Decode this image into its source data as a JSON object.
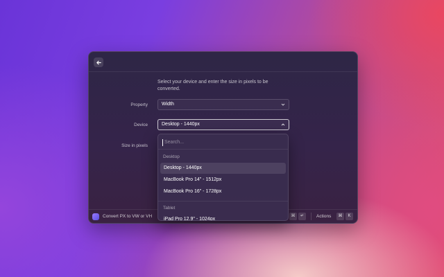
{
  "form": {
    "description": "Select your device and enter the size in pixels to be converted.",
    "property_label": "Property",
    "property_value": "Width",
    "device_label": "Device",
    "device_value": "Desktop - 1440px",
    "size_label": "Size in pixels"
  },
  "dropdown": {
    "search_placeholder": "Search...",
    "groups": [
      {
        "name": "Desktop",
        "options": [
          "Desktop - 1440px",
          "MacBook Pro 14\" - 1512px",
          "MacBook Pro 16\" - 1728px"
        ]
      },
      {
        "name": "Tablet",
        "options": [
          "iPad Pro 12.9\" - 1024px"
        ]
      }
    ],
    "selected": "Desktop - 1440px"
  },
  "footer": {
    "app_title": "Convert PX to VW or VH",
    "submit_keys": [
      "⌘",
      "↵"
    ],
    "actions_label": "Actions",
    "actions_keys": [
      "⌘",
      "K"
    ]
  },
  "icons": [
    "arrow-left-icon",
    "chevron-down-icon",
    "chevron-up-icon",
    "extension-icon"
  ]
}
